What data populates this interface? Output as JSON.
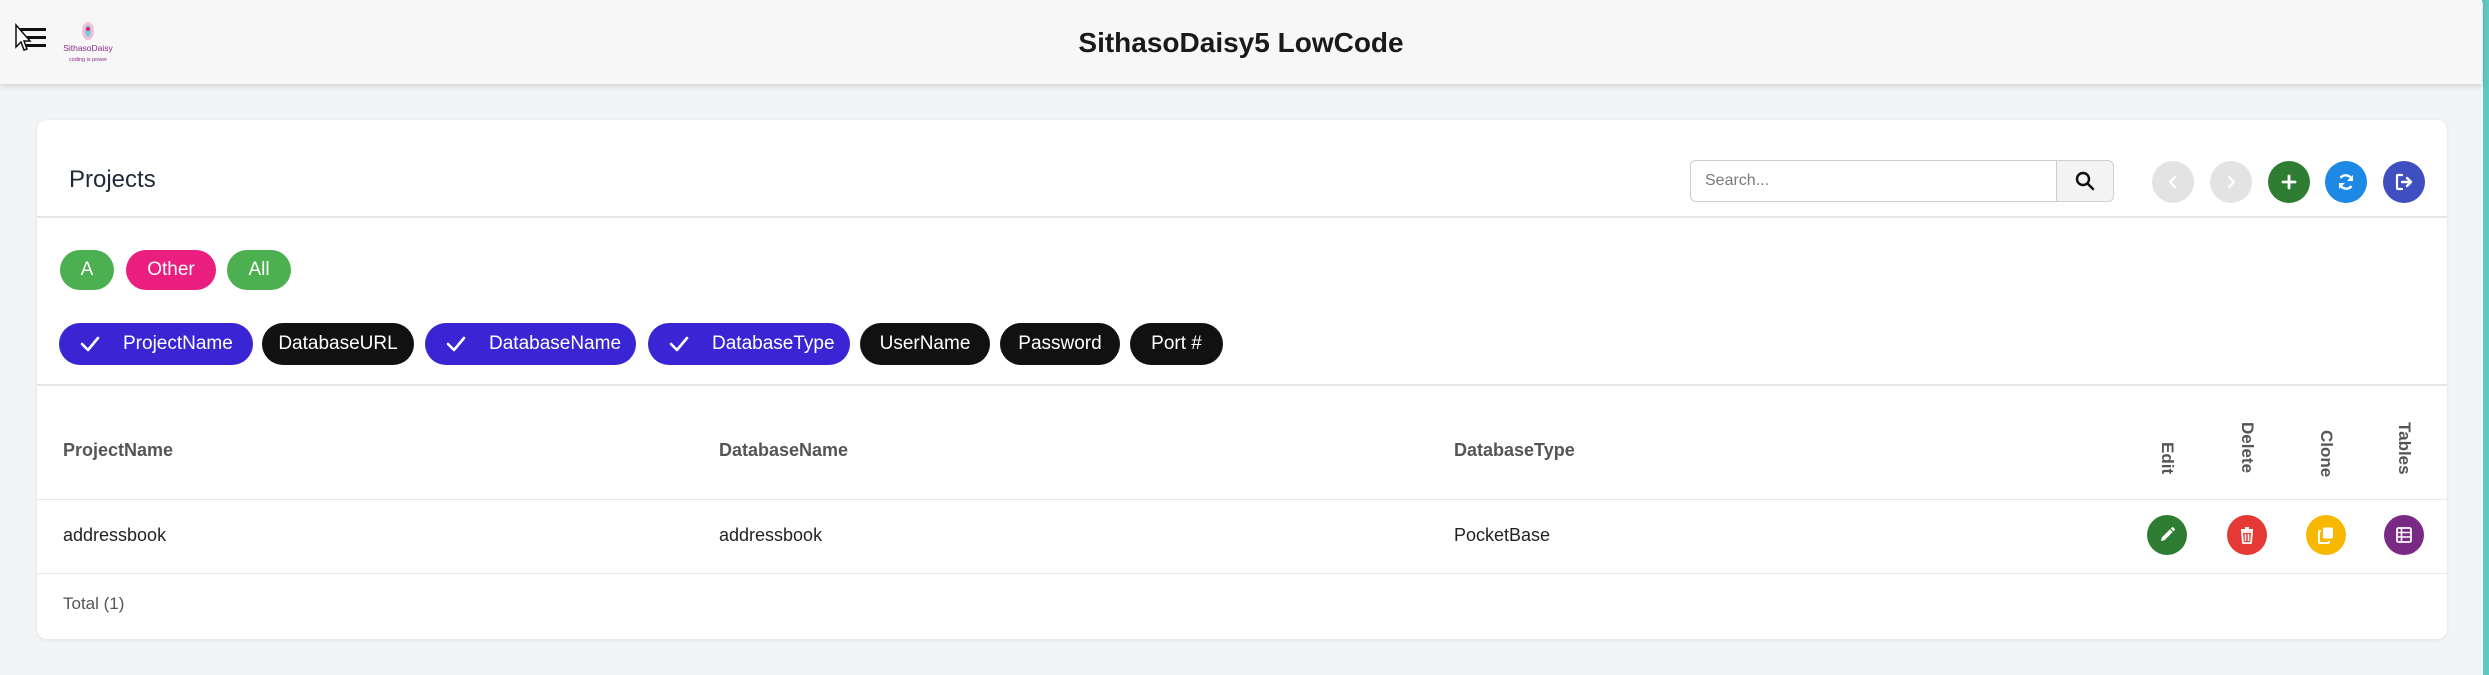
{
  "header": {
    "title": "SithasoDaisy5 LowCode",
    "logo_text": "SithasoDaisy",
    "logo_tagline": "coding is power"
  },
  "card": {
    "title": "Projects",
    "search": {
      "placeholder": "Search...",
      "value": ""
    }
  },
  "filters": {
    "groups": [
      {
        "label": "A",
        "color": "#4caf50"
      },
      {
        "label": "Other",
        "color": "#e91e7f"
      },
      {
        "label": "All",
        "color": "#4caf50"
      }
    ],
    "columns": [
      {
        "label": "ProjectName",
        "checked": true
      },
      {
        "label": "DatabaseURL",
        "checked": false
      },
      {
        "label": "DatabaseName",
        "checked": true
      },
      {
        "label": "DatabaseType",
        "checked": true
      },
      {
        "label": "UserName",
        "checked": false
      },
      {
        "label": "Password",
        "checked": false
      },
      {
        "label": "Port #",
        "checked": false
      }
    ]
  },
  "table": {
    "headers": [
      "ProjectName",
      "DatabaseName",
      "DatabaseType"
    ],
    "action_headers": [
      "Edit",
      "Delete",
      "Clone",
      "Tables"
    ],
    "rows": [
      {
        "cells": [
          "addressbook",
          "addressbook",
          "PocketBase"
        ]
      }
    ],
    "total": "Total (1)"
  },
  "colors": {
    "accent": "#3a25d4",
    "edit": "#2e7d32",
    "delete": "#e53935",
    "clone": "#f9b800",
    "tables": "#7a2a85",
    "add": "#2e7d32",
    "refresh": "#1e88e5",
    "exit": "#3f4fbf"
  },
  "icons": {
    "menu": "hamburger-icon",
    "search": "search-icon",
    "prev": "chevron-left-icon",
    "next": "chevron-right-icon",
    "add": "plus-icon",
    "refresh": "refresh-icon",
    "exit": "sign-out-icon",
    "edit": "pencil-icon",
    "delete": "trash-icon",
    "clone": "copy-icon",
    "tables": "table-list-icon"
  }
}
